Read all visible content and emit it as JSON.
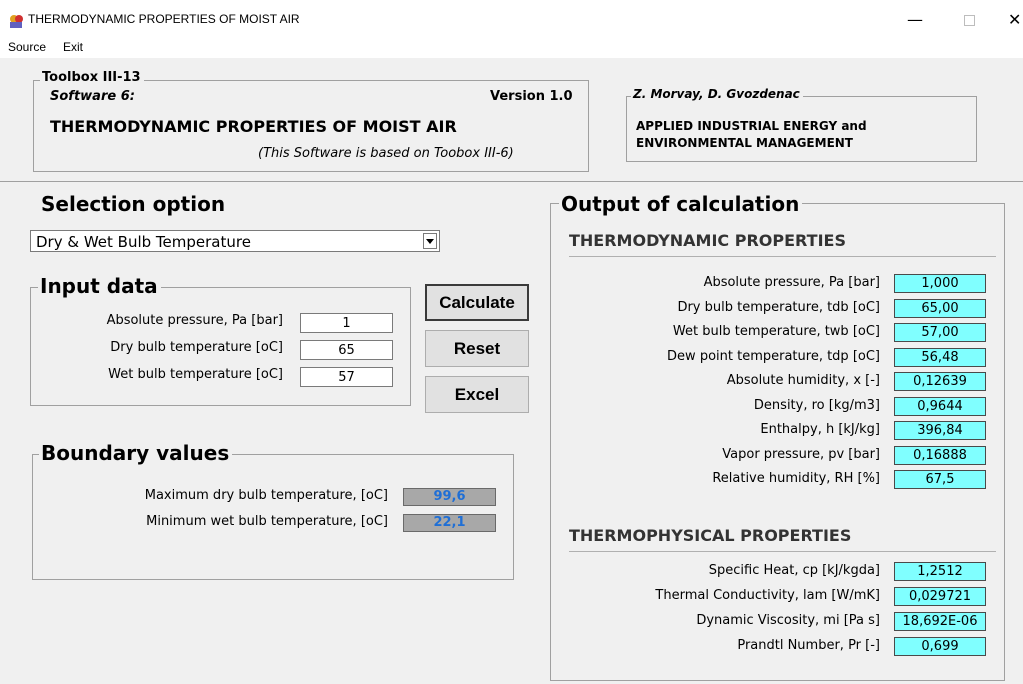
{
  "window": {
    "title": "THERMODYNAMIC PROPERTIES OF MOIST AIR",
    "minimize_glyph": "—",
    "close_glyph": "✕"
  },
  "menu": [
    {
      "label": "Source"
    },
    {
      "label": "Exit"
    }
  ],
  "header": {
    "toolbox_title": "Toolbox III-13",
    "software_label": "Software 6:",
    "version": "Version 1.0",
    "program_title": "THERMODYNAMIC PROPERTIES OF MOIST AIR",
    "based_on": "(This Software is based on Toobox III-6)",
    "authors_title": "Z. Morvay, D. Gvozdenac",
    "book_line1": "APPLIED INDUSTRIAL ENERGY and",
    "book_line2": "ENVIRONMENTAL MANAGEMENT"
  },
  "selection": {
    "heading": "Selection option",
    "selected": "Dry & Wet Bulb Temperature"
  },
  "input_data": {
    "heading": "Input data",
    "rows": [
      {
        "label": "Absolute pressure, Pa [bar]",
        "value": "1"
      },
      {
        "label": "Dry bulb temperature [oC]",
        "value": "65"
      },
      {
        "label": "Wet bulb temperature [oC]",
        "value": "57"
      }
    ]
  },
  "buttons": {
    "calculate": "Calculate",
    "reset": "Reset",
    "excel": "Excel"
  },
  "boundary": {
    "heading": "Boundary values",
    "rows": [
      {
        "label": "Maximum dry bulb temperature, [oC]",
        "value": "99,6"
      },
      {
        "label": "Minimum wet bulb temperature, [oC]",
        "value": "22,1"
      }
    ]
  },
  "output": {
    "heading": "Output of calculation",
    "thermo_heading": "THERMODYNAMIC PROPERTIES",
    "thermo_rows": [
      {
        "label": "Absolute pressure, Pa  [bar]",
        "value": "1,000"
      },
      {
        "label": "Dry bulb temperature, tdb  [oC]",
        "value": "65,00"
      },
      {
        "label": "Wet bulb temperature, twb  [oC]",
        "value": "57,00"
      },
      {
        "label": "Dew point temperature, tdp  [oC]",
        "value": "56,48"
      },
      {
        "label": "Absolute humidity, x  [-]",
        "value": "0,12639"
      },
      {
        "label": "Density, ro [kg/m3]",
        "value": "0,9644"
      },
      {
        "label": "Enthalpy, h  [kJ/kg]",
        "value": "396,84"
      },
      {
        "label": "Vapor pressure, pv  [bar]",
        "value": "0,16888"
      },
      {
        "label": "Relative humidity, RH  [%]",
        "value": "67,5"
      }
    ],
    "physical_heading": "THERMOPHYSICAL PROPERTIES",
    "physical_rows": [
      {
        "label": "Specific Heat, cp  [kJ/kgda]",
        "value": "1,2512"
      },
      {
        "label": "Thermal Conductivity, lam  [W/mK]",
        "value": "0,029721"
      },
      {
        "label": "Dynamic Viscosity, mi  [Pa s]",
        "value": "18,692E-06"
      },
      {
        "label": "Prandtl Number, Pr  [-]",
        "value": "0,699"
      }
    ]
  },
  "colors": {
    "output_field": "#80ffff",
    "boundary_field": "#a8a8a8",
    "boundary_text": "#1f6fd6"
  }
}
